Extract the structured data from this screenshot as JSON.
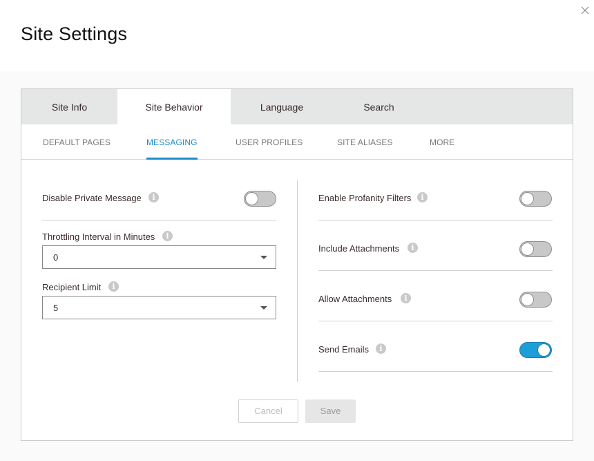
{
  "header": {
    "title": "Site Settings",
    "close_icon": "close-x-icon"
  },
  "tabs": [
    {
      "label": "Site Info",
      "active": false
    },
    {
      "label": "Site Behavior",
      "active": true
    },
    {
      "label": "Language",
      "active": false
    },
    {
      "label": "Search",
      "active": false
    }
  ],
  "subtabs": [
    {
      "label": "DEFAULT PAGES",
      "active": false
    },
    {
      "label": "MESSAGING",
      "active": true
    },
    {
      "label": "USER PROFILES",
      "active": false
    },
    {
      "label": "SITE ALIASES",
      "active": false
    },
    {
      "label": "MORE",
      "active": false
    }
  ],
  "left": {
    "disable_private_message": {
      "label": "Disable Private Message",
      "enabled": false,
      "icon": "info-icon"
    },
    "throttling_interval": {
      "label": "Throttling Interval in Minutes",
      "value": "0",
      "icon": "info-icon"
    },
    "recipient_limit": {
      "label": "Recipient Limit",
      "value": "5",
      "icon": "info-icon"
    }
  },
  "right": {
    "enable_profanity_filters": {
      "label": "Enable Profanity Filters",
      "enabled": false,
      "icon": "info-icon"
    },
    "include_attachments": {
      "label": "Include Attachments",
      "enabled": false,
      "icon": "info-icon"
    },
    "allow_attachments": {
      "label": "Allow Attachments",
      "enabled": false,
      "icon": "info-icon"
    },
    "send_emails": {
      "label": "Send Emails",
      "enabled": true,
      "icon": "info-icon"
    }
  },
  "info_glyph": "i",
  "buttons": {
    "cancel": "Cancel",
    "save": "Save"
  },
  "colors": {
    "accent": "#1d8bc7",
    "toggle_on": "#1e9ed8",
    "toggle_off": "#c8c8c8",
    "tab_bar": "#e5e6e6"
  }
}
